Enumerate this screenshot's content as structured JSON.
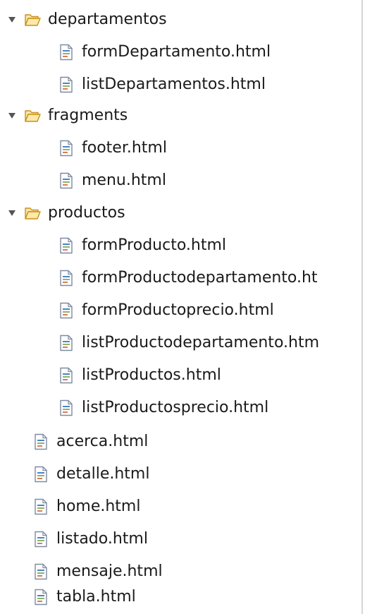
{
  "colors": {
    "folder_fill": "#fbe7a6",
    "folder_stroke": "#c8901e",
    "file_stroke": "#7e8aa0",
    "file_accent": "#4b84c6",
    "arrow": "#555555"
  },
  "icons": {
    "expanded": "triangle-down-icon",
    "folder": "folder-open-icon",
    "file": "html-file-icon"
  },
  "tree": {
    "folders": [
      {
        "name": "departamentos",
        "files": [
          "formDepartamento.html",
          "listDepartamentos.html"
        ]
      },
      {
        "name": "fragments",
        "files": [
          "footer.html",
          "menu.html"
        ]
      },
      {
        "name": "productos",
        "files": [
          "formProducto.html",
          "formProductodepartamento.ht",
          "formProductoprecio.html",
          "listProductodepartamento.htm",
          "listProductos.html",
          "listProductosprecio.html"
        ]
      }
    ],
    "root_files": [
      "acerca.html",
      "detalle.html",
      "home.html",
      "listado.html",
      "mensaje.html",
      "tabla.html"
    ]
  }
}
